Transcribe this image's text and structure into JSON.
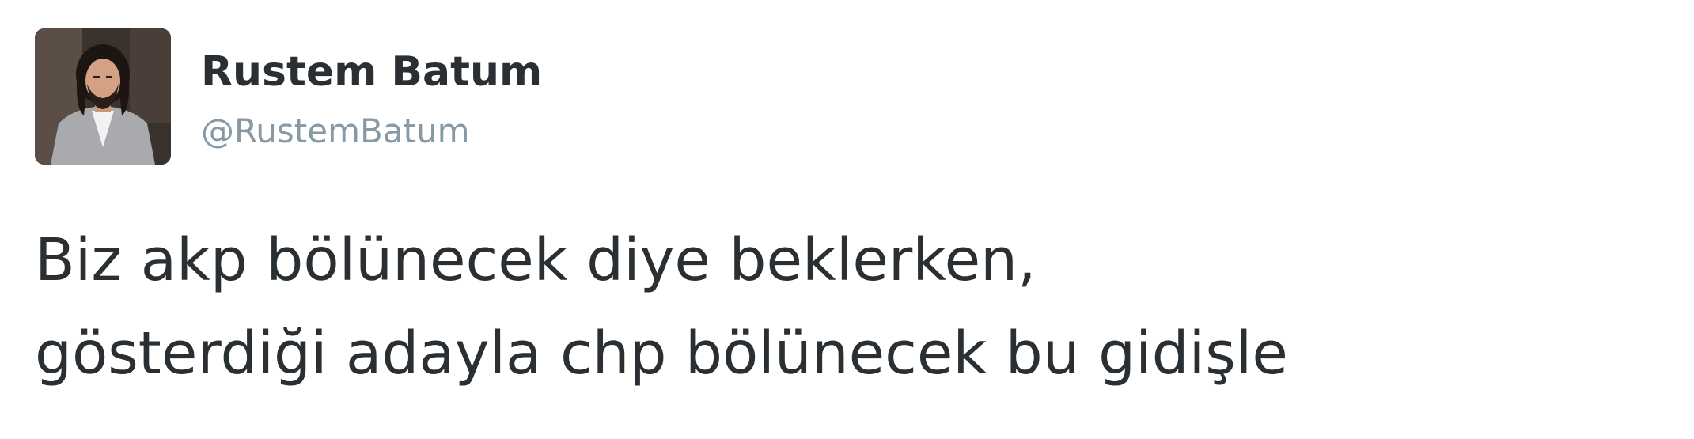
{
  "author": {
    "display_name": "Rustem Batum",
    "handle": "@RustemBatum",
    "avatar_icon": "user-avatar-photo"
  },
  "tweet": {
    "lines": [
      "Biz akp bölünecek diye beklerken,",
      "gösterdiği adayla chp bölünecek bu gidişle"
    ]
  },
  "colors": {
    "text": "#292f33",
    "secondary_text": "#8899a6",
    "background": "#ffffff"
  }
}
